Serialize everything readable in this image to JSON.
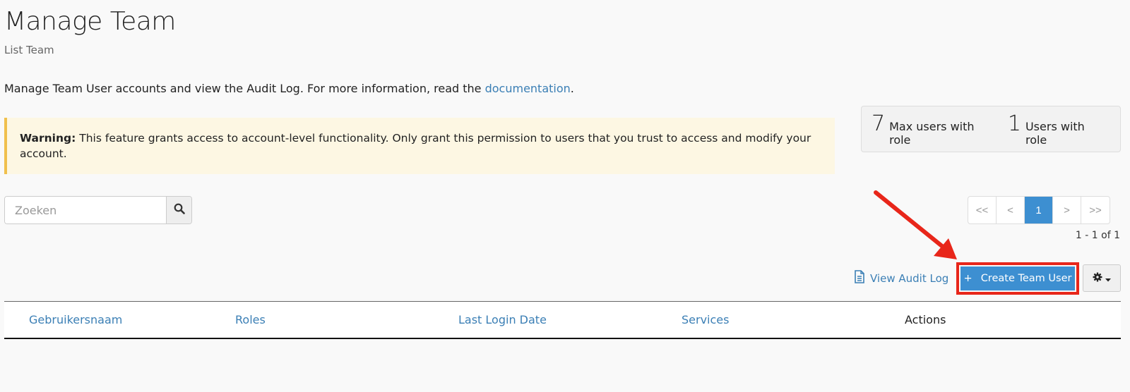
{
  "header": {
    "title": "Manage Team",
    "subtitle": "List Team"
  },
  "intro": {
    "text": "Manage Team User accounts and view the Audit Log. For more information, read the ",
    "link_label": "documentation",
    "suffix": "."
  },
  "warning": {
    "label": "Warning:",
    "text": " This feature grants access to account-level functionality. Only grant this permission to users that you trust to access and modify your account.",
    "accent_color": "#f0c04d"
  },
  "stats": [
    {
      "value": "7",
      "label": "Max users with role"
    },
    {
      "value": "1",
      "label": "Users with role"
    }
  ],
  "search": {
    "placeholder": "Zoeken",
    "value": "",
    "button_icon": "search-icon"
  },
  "pagination": {
    "first": "<<",
    "prev": "<",
    "current": "1",
    "next": ">",
    "last": ">>",
    "range_text": "1 - 1 of 1",
    "active_color": "#3d8fd1"
  },
  "actions": {
    "audit_log_label": "View Audit Log",
    "create_label": "Create Team User",
    "create_icon": "+",
    "settings_icon": "gear-icon",
    "highlight_color": "#e8261a"
  },
  "table": {
    "columns": [
      {
        "label": "Gebruikersnaam",
        "sortable": true
      },
      {
        "label": "Roles",
        "sortable": true
      },
      {
        "label": "Last Login Date",
        "sortable": true
      },
      {
        "label": "Services",
        "sortable": true
      },
      {
        "label": "Actions",
        "sortable": false
      }
    ],
    "rows": []
  }
}
